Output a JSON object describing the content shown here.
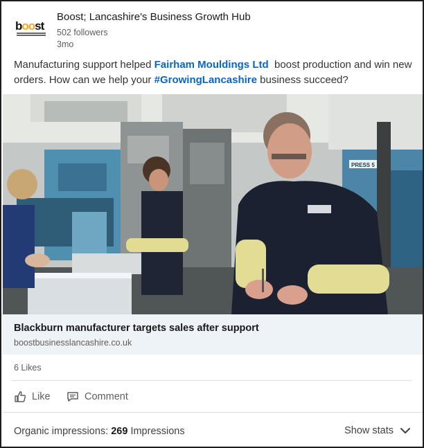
{
  "header": {
    "logo_text": "boost",
    "company_name": "Boost; Lancashire's Business Growth Hub",
    "followers": "502 followers",
    "time": "3mo"
  },
  "post": {
    "text_before": "Manufacturing support helped ",
    "mention": "Fairham Mouldings Ltd",
    "text_middle": "  boost production and win new orders. How can we help your ",
    "hashtag": "#GrowingLancashire",
    "text_after": " business succeed?"
  },
  "photo": {
    "sign_text": "PRESS 5"
  },
  "preview": {
    "title": "Blackburn manufacturer targets sales after support",
    "domain": "boostbusinesslancashire.co.uk"
  },
  "stats": {
    "likes": "6 Likes"
  },
  "actions": {
    "like_label": "Like",
    "comment_label": "Comment"
  },
  "footer": {
    "impressions_prefix": "Organic impressions: ",
    "impressions_count": "269",
    "impressions_suffix": " Impressions",
    "show_stats_label": "Show stats"
  },
  "colors": {
    "link": "#0a66c2",
    "preview_bg": "#eef3f8",
    "logo_accent": "#f5a623"
  },
  "icons": [
    "thumbs-up-icon",
    "comment-icon",
    "chevron-down-icon"
  ]
}
